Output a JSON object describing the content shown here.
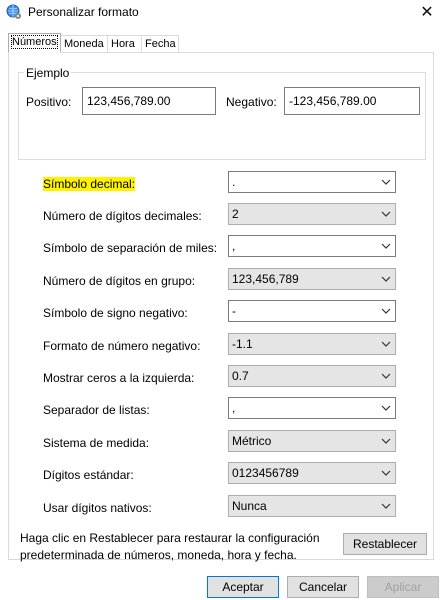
{
  "window": {
    "title": "Personalizar formato",
    "close_symbol": "✕"
  },
  "tabs": [
    {
      "label": "Números",
      "active": true
    },
    {
      "label": "Moneda",
      "active": false
    },
    {
      "label": "Hora",
      "active": false
    },
    {
      "label": "Fecha",
      "active": false
    }
  ],
  "example": {
    "legend": "Ejemplo",
    "positive_label": "Positivo:",
    "positive_value": "123,456,789.00",
    "negative_label": "Negativo:",
    "negative_value": "-123,456,789.00"
  },
  "settings": [
    {
      "label": "Símbolo decimal:",
      "value": ".",
      "highlighted": true,
      "editable": true
    },
    {
      "label": "Número de dígitos decimales:",
      "value": "2",
      "editable": false
    },
    {
      "label": "Símbolo de separación de miles:",
      "value": ",",
      "editable": true
    },
    {
      "label": "Número de dígitos en grupo:",
      "value": "123,456,789",
      "editable": false
    },
    {
      "label": "Símbolo de signo negativo:",
      "value": "-",
      "editable": true
    },
    {
      "label": "Formato de número negativo:",
      "value": "-1.1",
      "editable": false
    },
    {
      "label": "Mostrar ceros a la izquierda:",
      "value": "0.7",
      "editable": false
    },
    {
      "label": "Separador de listas:",
      "value": ",",
      "editable": true
    },
    {
      "label": "Sistema de medida:",
      "value": "Métrico",
      "editable": false
    },
    {
      "label": "Dígitos estándar:",
      "value": "0123456789",
      "editable": false
    },
    {
      "label": "Usar dígitos nativos:",
      "value": "Nunca",
      "editable": false
    }
  ],
  "info_text": "Haga clic en Restablecer para restaurar la configuración predeterminada de números, moneda, hora y fecha.",
  "buttons": {
    "reset": "Restablecer",
    "accept": "Aceptar",
    "cancel": "Cancelar",
    "apply": "Aplicar"
  },
  "colors": {
    "highlight": "#fff200",
    "focus_border": "#0078d7"
  }
}
